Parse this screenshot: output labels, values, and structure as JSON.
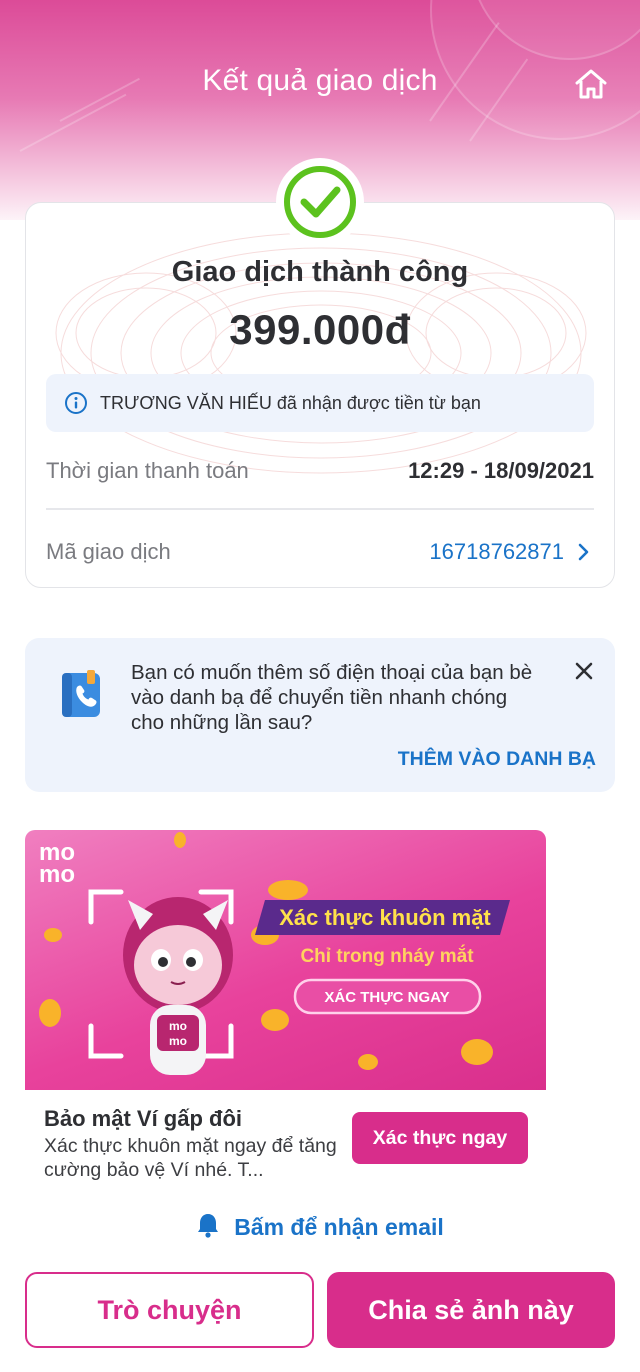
{
  "header": {
    "title": "Kết quả giao dịch",
    "home_icon": "home-icon"
  },
  "result": {
    "status_icon": "check-circle-icon",
    "status_title": "Giao dịch thành công",
    "amount": "399.000đ",
    "info_icon": "info-icon",
    "info_text": "TRƯƠNG VĂN HIẾU đã nhận được tiền từ bạn",
    "time_label": "Thời gian thanh toán",
    "time_value": "12:29 - 18/09/2021",
    "txn_label": "Mã giao dịch",
    "txn_value": "16718762871"
  },
  "contact_prompt": {
    "icon": "contact-book-icon",
    "text": "Bạn có muốn thêm số điện thoại của bạn bè vào danh bạ để chuyển tiền nhanh chóng cho những lần sau?",
    "action": "THÊM VÀO DANH BẠ"
  },
  "promo": {
    "banner": {
      "logo": "mo mo",
      "headline": "Xác thực khuôn mặt",
      "subline": "Chỉ trong nháy mắt",
      "cta": "XÁC THỰC NGAY"
    },
    "title": "Bảo mật Ví gấp đôi",
    "description": "Xác thực khuôn mặt ngay để tăng cường bảo vệ Ví nhé. T...",
    "button": "Xác thực ngay"
  },
  "email_link": "Bấm để nhận email",
  "footer": {
    "chat_button": "Trò chuyện",
    "share_button": "Chia sẻ ảnh này"
  },
  "colors": {
    "brand_pink": "#d82d8b",
    "link_blue": "#1a73c8",
    "success_green": "#5cc21e",
    "info_bg": "#eef3fc"
  }
}
